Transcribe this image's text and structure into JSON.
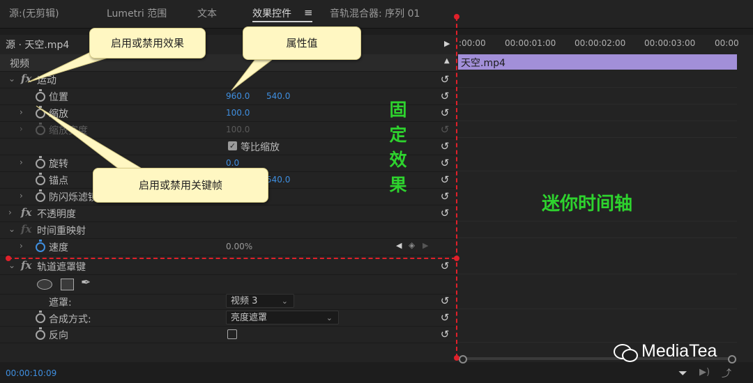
{
  "tabs": [
    {
      "label": "源:(无剪辑)"
    },
    {
      "label": "Lumetri 范围"
    },
    {
      "label": "文本"
    },
    {
      "label": "效果控件",
      "menu_icon": "hamburger-icon"
    },
    {
      "label": "音轨混合器: 序列 01"
    }
  ],
  "source_bar": {
    "label": "源 · 天空.mp4"
  },
  "timeline_ruler": {
    "ticks": [
      ":00:00",
      "00:00:01:00",
      "00:00:02:00",
      "00:00:03:00",
      "00:00"
    ]
  },
  "clip": {
    "label": "天空.mp4",
    "color": "#a28fd8"
  },
  "section_video": "视频",
  "effects": {
    "motion": {
      "label": "运动",
      "position": {
        "label": "位置",
        "x": "960.0",
        "y": "540.0"
      },
      "scale": {
        "label": "缩放",
        "value": "100.0"
      },
      "scale_width": {
        "label": "缩放宽度",
        "value": "100.0"
      },
      "uniform_scale": {
        "label": "等比缩放",
        "checked": true
      },
      "rotation": {
        "label": "旋转",
        "value": "0.0"
      },
      "anchor": {
        "label": "锚点",
        "y": "540.0"
      },
      "antiflicker": {
        "label": "防闪烁滤镜"
      }
    },
    "opacity": {
      "label": "不透明度"
    },
    "time_remap": {
      "label": "时间重映射",
      "speed": {
        "label": "速度",
        "value": "0.00%"
      }
    },
    "track_matte": {
      "label": "轨道遮罩键",
      "matte": {
        "label": "遮罩:",
        "value": "视频 3"
      },
      "composite": {
        "label": "合成方式:",
        "value": "亮度遮罩"
      },
      "reverse": {
        "label": "反向",
        "checked": false
      }
    }
  },
  "callouts": {
    "toggle_effect": "启用或禁用效果",
    "property_value": "属性值",
    "toggle_keyframe": "启用或禁用关键帧"
  },
  "annotations": {
    "fixed_effects": [
      "固",
      "定",
      "效",
      "果"
    ],
    "mini_timeline": "迷你时间轴"
  },
  "timecode": "00:00:10:09",
  "watermark": "MediaTea",
  "colors": {
    "accent_blue": "#3f8fe0",
    "guide_red": "#e0202a",
    "annotation_green": "#2ed32e",
    "callout_bg": "#fff7c2"
  }
}
